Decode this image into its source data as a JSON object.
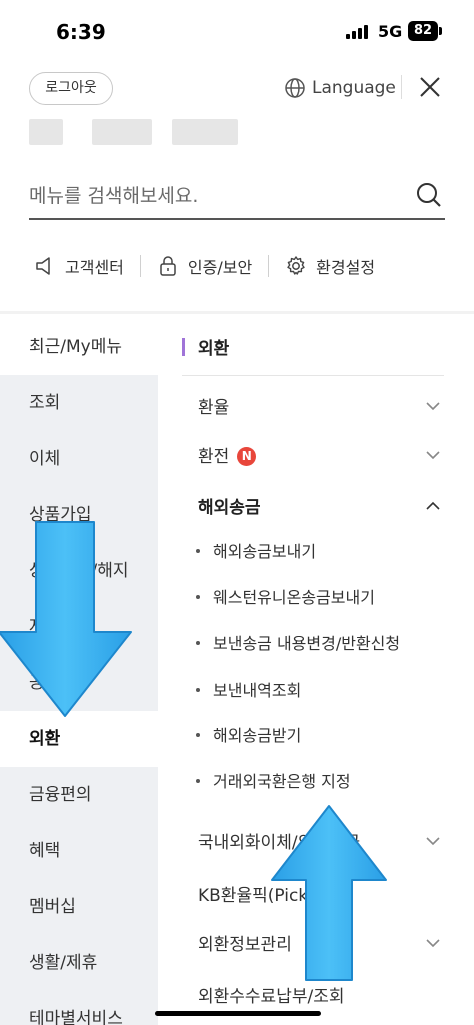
{
  "status_bar": {
    "time": "6:39",
    "network": "5G",
    "battery": "82"
  },
  "header": {
    "logout_label": "로그아웃",
    "language_label": "Language",
    "close_icon": "close-icon"
  },
  "search": {
    "placeholder": "메뉴를 검색해보세요.",
    "icon": "search-icon"
  },
  "quick_links": [
    {
      "label": "고객센터",
      "icon": "megaphone-icon"
    },
    {
      "label": "인증/보안",
      "icon": "lock-icon"
    },
    {
      "label": "환경설정",
      "icon": "gear-icon"
    }
  ],
  "left_nav": {
    "items": [
      {
        "label": "최근/My메뉴"
      },
      {
        "label": "조회"
      },
      {
        "label": "이체"
      },
      {
        "label": "상품가입"
      },
      {
        "label": "상품관리/해지"
      },
      {
        "label": "자산관리"
      },
      {
        "label": "공과금"
      },
      {
        "label": "외환"
      },
      {
        "label": "금융편의"
      },
      {
        "label": "혜택"
      },
      {
        "label": "멤버십"
      },
      {
        "label": "생활/제휴"
      },
      {
        "label": "테마별서비스"
      }
    ],
    "active": "외환"
  },
  "panel": {
    "title": "외환",
    "rows": [
      {
        "label": "환율",
        "expandable": true
      },
      {
        "label": "환전",
        "badge": "N",
        "expandable": true
      },
      {
        "label": "해외송금",
        "expanded": true
      },
      {
        "label": "국내외화이체/외화출금",
        "expandable": true
      },
      {
        "label": "KB환율픽(Pick)"
      },
      {
        "label": "외환정보관리",
        "expandable": true
      },
      {
        "label": "외환수수료납부/조회"
      }
    ],
    "sub_items": [
      {
        "label": "해외송금보내기"
      },
      {
        "label": "웨스턴유니온송금보내기"
      },
      {
        "label": "보낸송금 내용변경/반환신청"
      },
      {
        "label": "보낸내역조회"
      },
      {
        "label": "해외송금받기"
      },
      {
        "label": "거래외국환은행 지정"
      }
    ]
  },
  "colors": {
    "accent": "#a074d8",
    "badge": "#e8463b",
    "arrow": "#3fb4f3",
    "nav_bg": "#eef0f3"
  }
}
